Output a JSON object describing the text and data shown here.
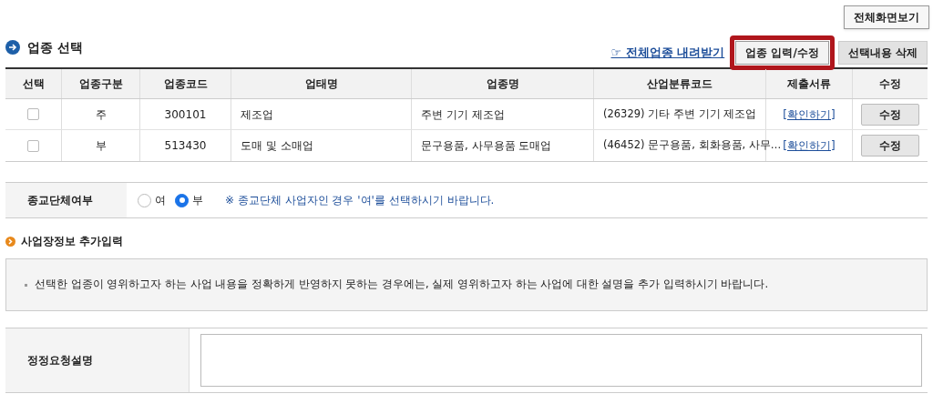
{
  "fullscreen_button": "전체화면보기",
  "section_title": "업종 선택",
  "download_link": "☞ 전체업종 내려받기",
  "actions": [
    {
      "label": "업종 입력/수정",
      "highlighted": true
    },
    {
      "label": "선택내용 삭제",
      "highlighted": false
    }
  ],
  "table": {
    "columns": [
      "선택",
      "업종구분",
      "업종코드",
      "업태명",
      "업종명",
      "산업분류코드",
      "제출서류",
      "수정"
    ],
    "rows": [
      {
        "checked": false,
        "type": "주",
        "code": "300101",
        "business_type": "제조업",
        "industry_name": "주변 기기 제조업",
        "classification": "(26329) 기타 주변 기기 제조업",
        "documents_link": "[확인하기]",
        "edit_button": "수정"
      },
      {
        "checked": false,
        "type": "부",
        "code": "513430",
        "business_type": "도매 및 소매업",
        "industry_name": "문구용품, 사무용품 도매업",
        "classification": "(46452) 문구용품, 회화용품, 사무…",
        "documents_link": "[확인하기]",
        "edit_button": "수정"
      }
    ]
  },
  "religious": {
    "label": "종교단체여부",
    "options": [
      {
        "label": "여",
        "selected": false
      },
      {
        "label": "부",
        "selected": true
      }
    ],
    "note": "※ 종교단체 사업자인 경우 '여'를 선택하시기 바랍니다."
  },
  "extra_title": "사업장정보 추가입력",
  "notice": "선택한 업종이 영위하고자 하는 사업 내용을 정확하게 반영하지 못하는 경우에는, 실제 영위하고자 하는 사업에 대한 설명을 추가 입력하시기 바랍니다.",
  "correction": {
    "label": "정정요청설명"
  }
}
